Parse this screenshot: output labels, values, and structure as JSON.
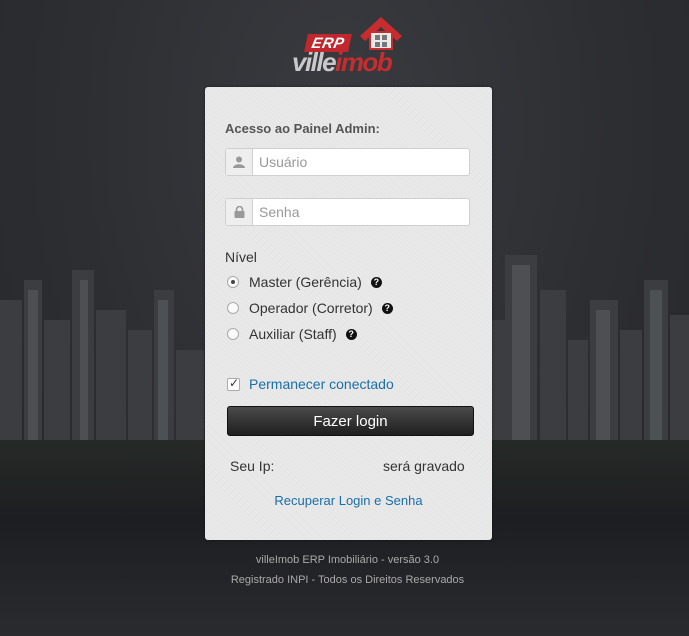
{
  "logo": {
    "badge": "ERP",
    "name_part1": "ville",
    "name_part2": "imob"
  },
  "panel": {
    "title": "Acesso ao Painel Admin:",
    "username_placeholder": "Usuário",
    "password_placeholder": "Senha",
    "level_label": "Nível",
    "levels": [
      {
        "label": "Master (Gerência)",
        "checked": true
      },
      {
        "label": "Operador (Corretor)",
        "checked": false
      },
      {
        "label": "Auxiliar (Staff)",
        "checked": false
      }
    ],
    "help_glyph": "?",
    "remember_label": "Permanecer conectado",
    "remember_checked": true,
    "login_button": "Fazer login",
    "ip_label": "Seu Ip:",
    "ip_note": "será gravado",
    "recover_link": "Recuperar Login e Senha"
  },
  "footer": {
    "line1": "villeImob ERP Imobiliário - versão 3.0",
    "line2": "Registrado INPI - Todos os Direitos Reservados"
  },
  "icons": {
    "username": "user-icon",
    "password": "lock-icon",
    "help": "question-circle-icon",
    "logo_house": "house-icon"
  },
  "colors": {
    "brand_red": "#c0282d",
    "link_blue": "#1a6fa8",
    "button_dark": "#1f1f1f",
    "background": "#2f3034"
  }
}
